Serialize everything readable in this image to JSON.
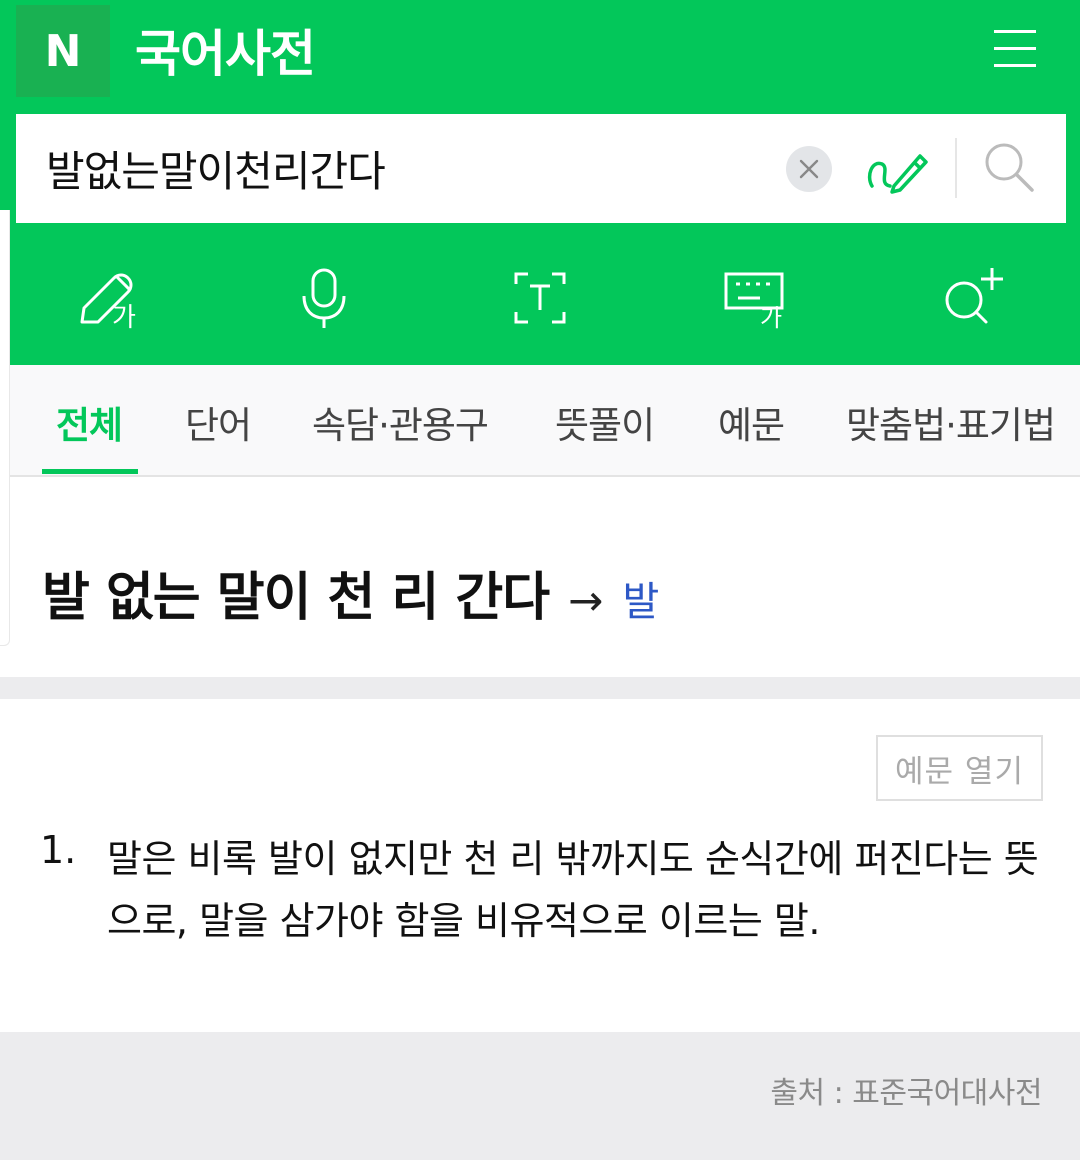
{
  "header": {
    "logo_letter": "N",
    "title": "국어사전",
    "accent": "#03c75a",
    "menu_icon": "hamburger-menu-icon"
  },
  "search": {
    "value": "발없는말이천리간다",
    "clear_icon": "close-icon",
    "handwriting_icon": "pen-icon",
    "search_icon": "search-icon"
  },
  "tools": [
    {
      "icon": "handwriting-input-icon"
    },
    {
      "icon": "microphone-icon"
    },
    {
      "icon": "text-scan-icon"
    },
    {
      "icon": "keyboard-icon"
    },
    {
      "icon": "search-plus-icon"
    }
  ],
  "tabs": [
    {
      "label": "전체",
      "active": true
    },
    {
      "label": "단어",
      "active": false
    },
    {
      "label": "속담·관용구",
      "active": false
    },
    {
      "label": "뜻풀이",
      "active": false
    },
    {
      "label": "예문",
      "active": false
    },
    {
      "label": "맞춤법·표기법",
      "active": false
    }
  ],
  "entry": {
    "title": "발 없는 말이 천 리 간다",
    "arrow": "→",
    "link": "발",
    "link_color": "#2d58c6"
  },
  "definition": {
    "example_button": "예문 열기",
    "number": "1.",
    "text": "말은 비록 발이 없지만 천 리 밖까지도 순식간에 퍼진다는 뜻으로, 말을 삼가야 함을 비유적으로 이르는 말."
  },
  "footer": {
    "source": "출처 : 표준국어대사전"
  }
}
